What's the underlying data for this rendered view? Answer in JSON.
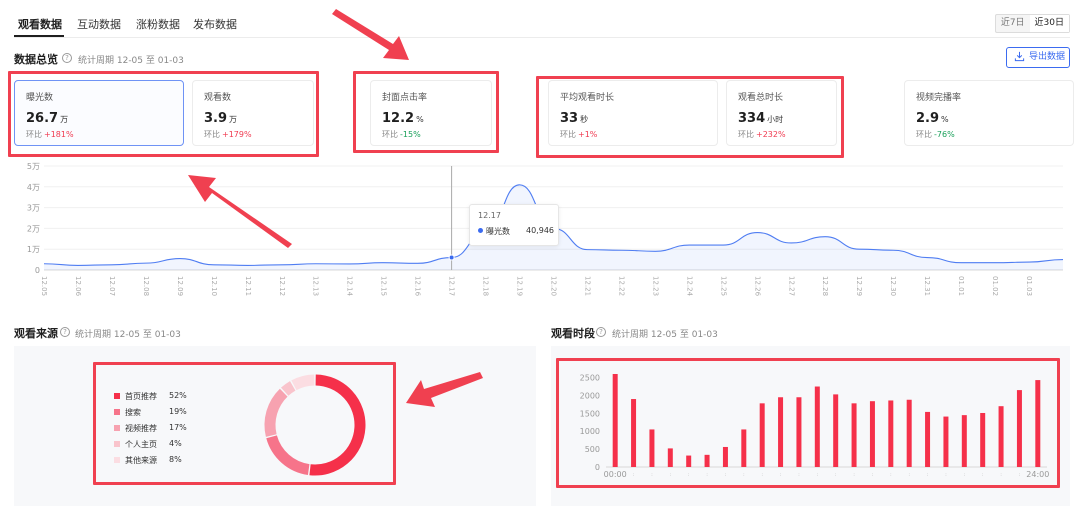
{
  "tabs": [
    {
      "label": "观看数据",
      "active": true
    },
    {
      "label": "互动数据",
      "active": false
    },
    {
      "label": "涨粉数据",
      "active": false
    },
    {
      "label": "发布数据",
      "active": false
    }
  ],
  "date_range": {
    "options": [
      "近7日",
      "近30日"
    ],
    "selected": "近30日"
  },
  "overview": {
    "title": "数据总览",
    "period": "统计周期 12-05 至 01-03",
    "export_label": "导出数据"
  },
  "metrics": [
    {
      "label": "曝光数",
      "value": "26.7",
      "unit": "万",
      "cmp_label": "环比",
      "cmp_value": "+181%",
      "trend": "up",
      "selected": true
    },
    {
      "label": "观看数",
      "value": "3.9",
      "unit": "万",
      "cmp_label": "环比",
      "cmp_value": "+179%",
      "trend": "up",
      "selected": false
    },
    {
      "label": "封面点击率",
      "value": "12.2",
      "unit": "%",
      "cmp_label": "环比",
      "cmp_value": "-15%",
      "trend": "down",
      "selected": false
    },
    {
      "label": "平均观看时长",
      "value": "33",
      "unit": "秒",
      "cmp_label": "环比",
      "cmp_value": "+1%",
      "trend": "up",
      "selected": false
    },
    {
      "label": "观看总时长",
      "value": "334",
      "unit": "小时",
      "cmp_label": "环比",
      "cmp_value": "+232%",
      "trend": "up",
      "selected": false
    },
    {
      "label": "视频完播率",
      "value": "2.9",
      "unit": "%",
      "cmp_label": "环比",
      "cmp_value": "-76%",
      "trend": "down",
      "selected": false
    }
  ],
  "tooltip": {
    "date": "12.17",
    "series": "曝光数",
    "value": "40,946"
  },
  "source": {
    "title": "观看来源",
    "period": "统计周期 12-05 至 01-03"
  },
  "timeslot": {
    "title": "观看时段",
    "period": "统计周期 12-05 至 01-03"
  },
  "colors": {
    "accent": "#3b6bf0",
    "red": "#f5304a",
    "up": "#f03a50",
    "down": "#1aa05a",
    "annotation": "#f04050"
  },
  "chart_data": [
    {
      "type": "area",
      "series": [
        {
          "name": "曝光数",
          "values": [
            3000,
            2200,
            2500,
            3300,
            5500,
            2500,
            2200,
            2500,
            3000,
            2900,
            3500,
            3200,
            6000,
            18000,
            40946,
            20000,
            9800,
            9500,
            9000,
            12000,
            12000,
            18000,
            13000,
            16000,
            10000,
            9500,
            6000,
            3500,
            3500,
            3800,
            5000
          ]
        }
      ],
      "x": [
        "12.05",
        "12.06",
        "12.07",
        "12.08",
        "12.09",
        "12.10",
        "12.11",
        "12.12",
        "12.13",
        "12.14",
        "12.15",
        "12.16",
        "12.17",
        "12.18",
        "12.19",
        "12.20",
        "12.21",
        "12.22",
        "12.23",
        "12.24",
        "12.25",
        "12.26",
        "12.27",
        "12.28",
        "12.29",
        "12.30",
        "12.31",
        "01.01",
        "01.02",
        "01.03"
      ],
      "yticks": [
        "0",
        "1万",
        "2万",
        "3万",
        "4万",
        "5万"
      ],
      "ylim": [
        0,
        50000
      ],
      "highlight_x": "12.17"
    },
    {
      "type": "pie",
      "categories": [
        "首页推荐",
        "搜索",
        "视频推荐",
        "个人主页",
        "其他来源"
      ],
      "values": [
        52,
        19,
        17,
        4,
        8
      ],
      "labels": [
        "52%",
        "19%",
        "17%",
        "4%",
        "8%"
      ],
      "colors": [
        "#f5304a",
        "#f6748a",
        "#f7a2b0",
        "#f9c4cc",
        "#fbdde2"
      ]
    },
    {
      "type": "bar",
      "categories": [
        "00:00",
        "01:00",
        "02:00",
        "03:00",
        "04:00",
        "05:00",
        "06:00",
        "07:00",
        "08:00",
        "09:00",
        "10:00",
        "11:00",
        "12:00",
        "13:00",
        "14:00",
        "15:00",
        "16:00",
        "17:00",
        "18:00",
        "19:00",
        "20:00",
        "21:00",
        "22:00",
        "23:00"
      ],
      "values": [
        2600,
        1900,
        1050,
        520,
        320,
        340,
        560,
        1050,
        1780,
        1950,
        1950,
        2250,
        2030,
        1780,
        1840,
        1860,
        1880,
        1540,
        1410,
        1450,
        1510,
        1700,
        2150,
        2430
      ],
      "tick_labels": [
        "00:00",
        "24:00"
      ],
      "yticks": [
        "0",
        "500",
        "1000",
        "1500",
        "2000",
        "2500"
      ],
      "ylim": [
        0,
        2600
      ],
      "color": "#f5304a"
    }
  ]
}
